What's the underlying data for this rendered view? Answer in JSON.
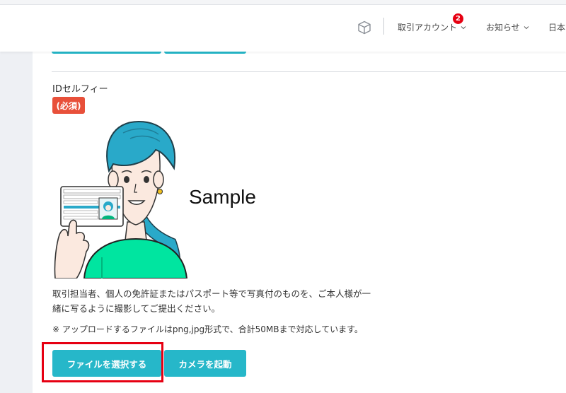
{
  "header": {
    "account_menu_label": "取引アカウント",
    "notification_count": "2",
    "notices_label": "お知らせ",
    "language_label": "日本"
  },
  "form": {
    "field_label": "IDセルフィー",
    "required_badge": "(必須)",
    "sample_label": "Sample",
    "description_line1": "取引担当者、個人の免許証またはパスポート等で写真付のものを、ご本人様が一",
    "description_line2": "緒に写るように撮影してご提出ください。",
    "note": "※ アップロードするファイルはpng,jpg形式で、合計50MBまで対応しています。",
    "select_file_button": "ファイルを選択する",
    "camera_button": "カメラを起動"
  },
  "colors": {
    "accent": "#26b7c9",
    "required": "#e8503a",
    "highlight": "#e60012",
    "hair": "#29a9c9",
    "shirt": "#00e5a0"
  },
  "icons": {
    "header_cube": "cube-icon",
    "dropdown": "chevron-down-icon"
  }
}
